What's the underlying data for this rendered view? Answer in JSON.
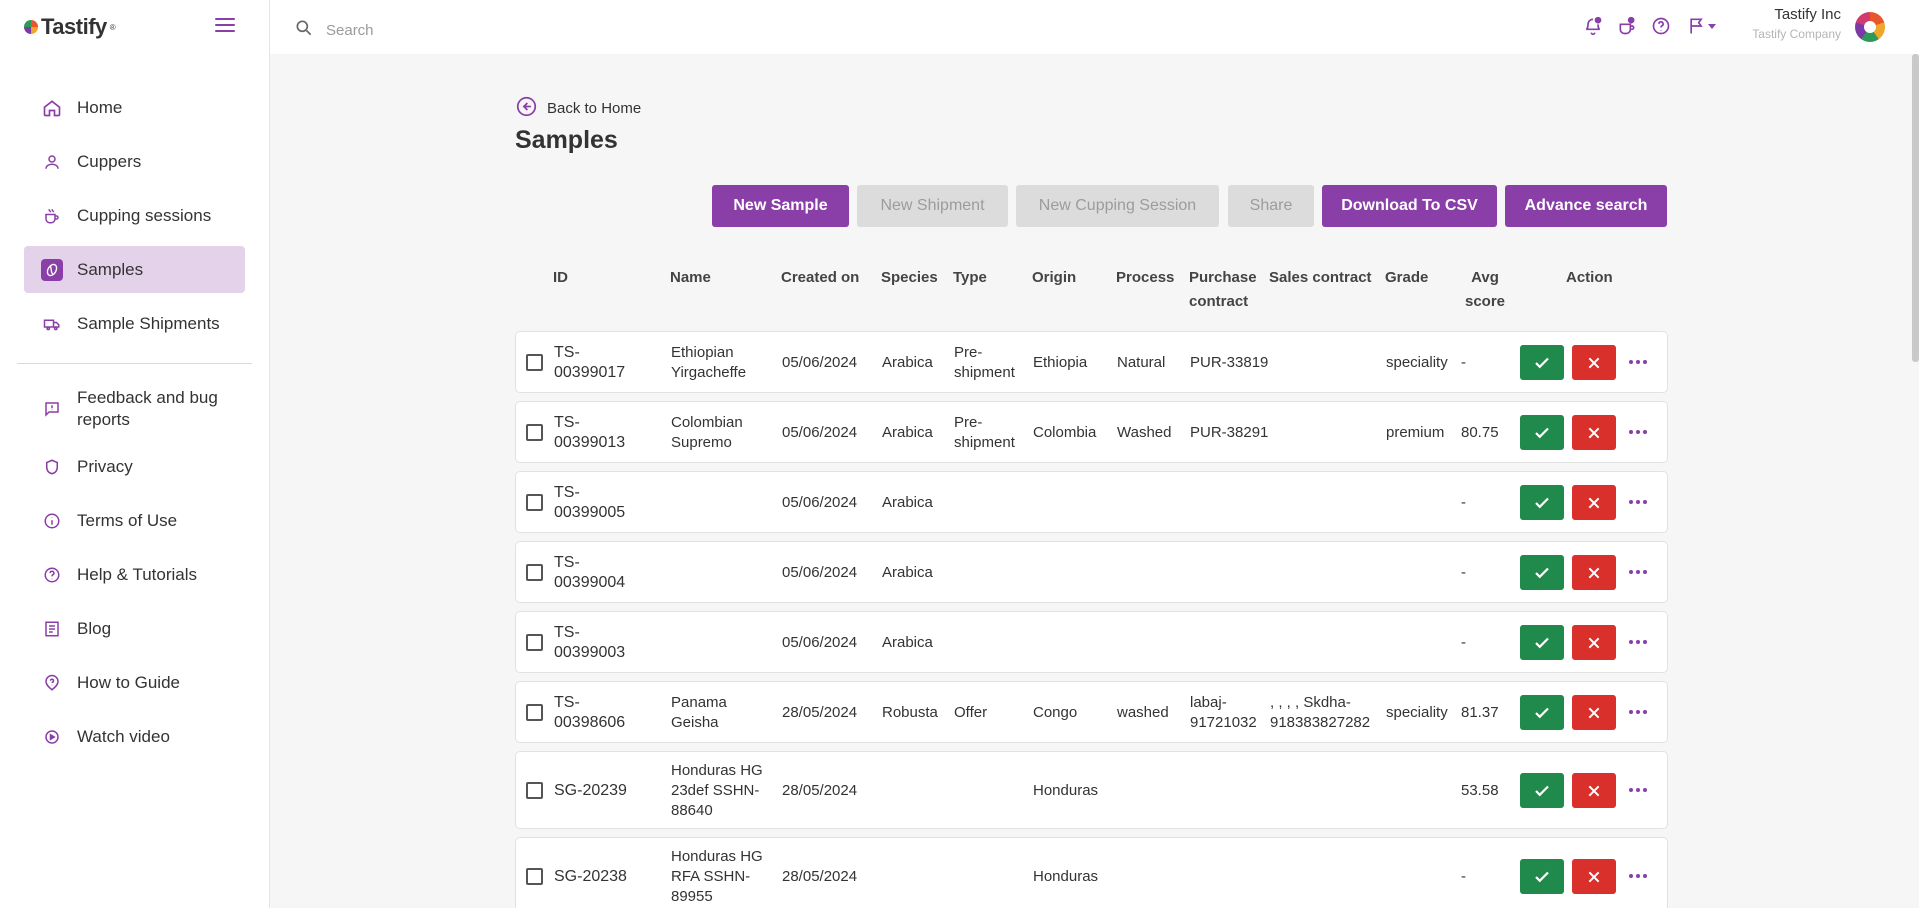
{
  "app": {
    "logo_text": "Tastify",
    "logo_mark": "®"
  },
  "sidebar": {
    "items": [
      {
        "label": "Home",
        "icon": "home-icon"
      },
      {
        "label": "Cuppers",
        "icon": "person-icon"
      },
      {
        "label": "Cupping sessions",
        "icon": "cup-icon"
      },
      {
        "label": "Samples",
        "icon": "coffee-bean-icon",
        "active": true
      },
      {
        "label": "Sample Shipments",
        "icon": "truck-icon"
      }
    ],
    "items2": [
      {
        "label": "Feedback and bug reports",
        "icon": "feedback-icon"
      },
      {
        "label": "Privacy",
        "icon": "shield-icon"
      },
      {
        "label": "Terms of Use",
        "icon": "info-icon"
      },
      {
        "label": "Help & Tutorials",
        "icon": "help-icon"
      },
      {
        "label": "Blog",
        "icon": "blog-icon"
      },
      {
        "label": "How to Guide",
        "icon": "guide-icon"
      },
      {
        "label": "Watch video",
        "icon": "play-icon"
      }
    ]
  },
  "topbar": {
    "search_placeholder": "Search",
    "user_name": "Tastify Inc",
    "company": "Tastify Company"
  },
  "main": {
    "back_label": "Back to Home",
    "title": "Samples",
    "buttons": {
      "new_sample": "New Sample",
      "new_shipment": "New Shipment",
      "new_cupping_session": "New Cupping Session",
      "share": "Share",
      "download_csv": "Download To CSV",
      "advanced_search": "Advance search"
    },
    "columns": {
      "id": "ID",
      "name": "Name",
      "created_on": "Created on",
      "species": "Species",
      "type": "Type",
      "origin": "Origin",
      "process": "Process",
      "purchase_contract": "Purchase contract",
      "sales_contract": "Sales contract",
      "grade": "Grade",
      "avg_score": "Avg score",
      "action": "Action"
    },
    "rows": [
      {
        "id": "TS-00399017",
        "name": "Ethiopian Yirgacheffe",
        "created": "05/06/2024",
        "species": "Arabica",
        "type": "Pre-shipment",
        "origin": "Ethiopia",
        "process": "Natural",
        "purchase": "PUR-33819",
        "sales": "",
        "grade": "speciality",
        "score": "-"
      },
      {
        "id": "TS-00399013",
        "name": "Colombian Supremo",
        "created": "05/06/2024",
        "species": "Arabica",
        "type": "Pre-shipment",
        "origin": "Colombia",
        "process": "Washed",
        "purchase": "PUR-38291",
        "sales": "",
        "grade": "premium",
        "score": "80.75"
      },
      {
        "id": "TS-00399005",
        "name": "",
        "created": "05/06/2024",
        "species": "Arabica",
        "type": "",
        "origin": "",
        "process": "",
        "purchase": "",
        "sales": "",
        "grade": "",
        "score": "-"
      },
      {
        "id": "TS-00399004",
        "name": "",
        "created": "05/06/2024",
        "species": "Arabica",
        "type": "",
        "origin": "",
        "process": "",
        "purchase": "",
        "sales": "",
        "grade": "",
        "score": "-"
      },
      {
        "id": "TS-00399003",
        "name": "",
        "created": "05/06/2024",
        "species": "Arabica",
        "type": "",
        "origin": "",
        "process": "",
        "purchase": "",
        "sales": "",
        "grade": "",
        "score": "-"
      },
      {
        "id": "TS-00398606",
        "name": "Panama Geisha",
        "created": "28/05/2024",
        "species": "Robusta",
        "type": "Offer",
        "origin": "Congo",
        "process": "washed",
        "purchase": "labaj-91721032",
        "sales": ", , , , Skdha-918383827282",
        "grade": "speciality",
        "score": "81.37"
      },
      {
        "id": "SG-20239",
        "name": "Honduras HG 23def SSHN-88640",
        "created": "28/05/2024",
        "species": "",
        "type": "",
        "origin": "Honduras",
        "process": "",
        "purchase": "",
        "sales": "",
        "grade": "",
        "score": "53.58"
      },
      {
        "id": "SG-20238",
        "name": "Honduras HG RFA SSHN-89955",
        "created": "28/05/2024",
        "species": "",
        "type": "",
        "origin": "Honduras",
        "process": "",
        "purchase": "",
        "sales": "",
        "grade": "",
        "score": "-"
      }
    ]
  },
  "colors": {
    "accent": "#8a3fa8",
    "accent_light": "#e4d2ea",
    "approve": "#1f8a4c",
    "reject": "#d9302c"
  }
}
